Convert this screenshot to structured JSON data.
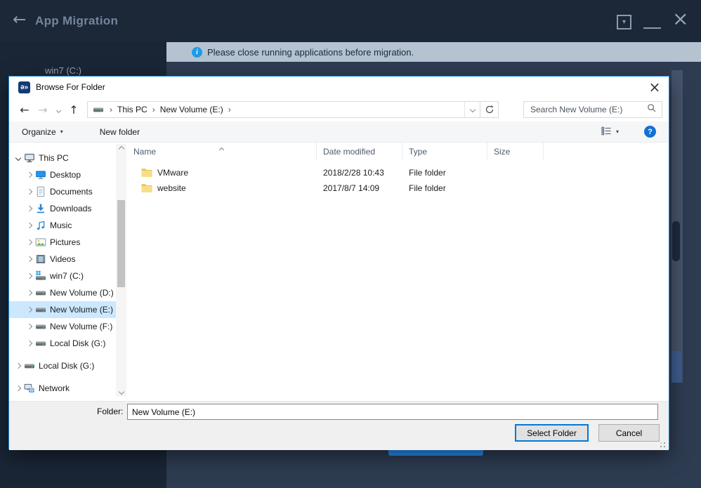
{
  "app": {
    "title": "App Migration",
    "notification": "Please close running applications before migration.",
    "partial_sidebar_item": "win7 (C:)"
  },
  "dialog": {
    "title": "Browse For Folder",
    "nav": {
      "breadcrumbs": [
        "This PC",
        "New Volume (E:)"
      ],
      "search_placeholder": "Search New Volume (E:)"
    },
    "toolbar": {
      "organize_label": "Organize",
      "new_folder_label": "New folder"
    },
    "tree_items": [
      {
        "label": "This PC",
        "icon": "pc",
        "level": 0,
        "expanded": true
      },
      {
        "label": "Desktop",
        "icon": "desktop",
        "level": 1
      },
      {
        "label": "Documents",
        "icon": "documents",
        "level": 1
      },
      {
        "label": "Downloads",
        "icon": "downloads",
        "level": 1
      },
      {
        "label": "Music",
        "icon": "music",
        "level": 1
      },
      {
        "label": "Pictures",
        "icon": "pictures",
        "level": 1
      },
      {
        "label": "Videos",
        "icon": "videos",
        "level": 1
      },
      {
        "label": "win7 (C:)",
        "icon": "drive-os",
        "level": 1
      },
      {
        "label": "New Volume (D:)",
        "icon": "drive",
        "level": 1
      },
      {
        "label": "New Volume (E:)",
        "icon": "drive",
        "level": 1,
        "selected": true
      },
      {
        "label": "New Volume (F:)",
        "icon": "drive",
        "level": 1
      },
      {
        "label": "Local Disk (G:)",
        "icon": "drive",
        "level": 1
      },
      {
        "label": "Local Disk (G:)",
        "icon": "drive",
        "level": 0,
        "gap": true
      },
      {
        "label": "Network",
        "icon": "network",
        "level": 0,
        "gap": true
      }
    ],
    "file_list": {
      "columns": [
        "Name",
        "Date modified",
        "Type",
        "Size"
      ],
      "rows": [
        {
          "name": "VMware",
          "date_modified": "2018/2/28 10:43",
          "type": "File folder",
          "size": ""
        },
        {
          "name": "website",
          "date_modified": "2017/8/7 14:09",
          "type": "File folder",
          "size": ""
        }
      ]
    },
    "footer": {
      "folder_label": "Folder:",
      "folder_value": "New Volume (E:)",
      "select_label": "Select Folder",
      "cancel_label": "Cancel"
    }
  },
  "colors": {
    "app_bar": "#1c2738",
    "sidebar": "#1a2636",
    "main_bg": "#2e3c52",
    "notification_bg": "#b5c3d1",
    "dialog_border": "#1d86d8",
    "selection": "#cce8ff",
    "accent_button": "#268ef5",
    "folder_icon": "#f7de85"
  }
}
